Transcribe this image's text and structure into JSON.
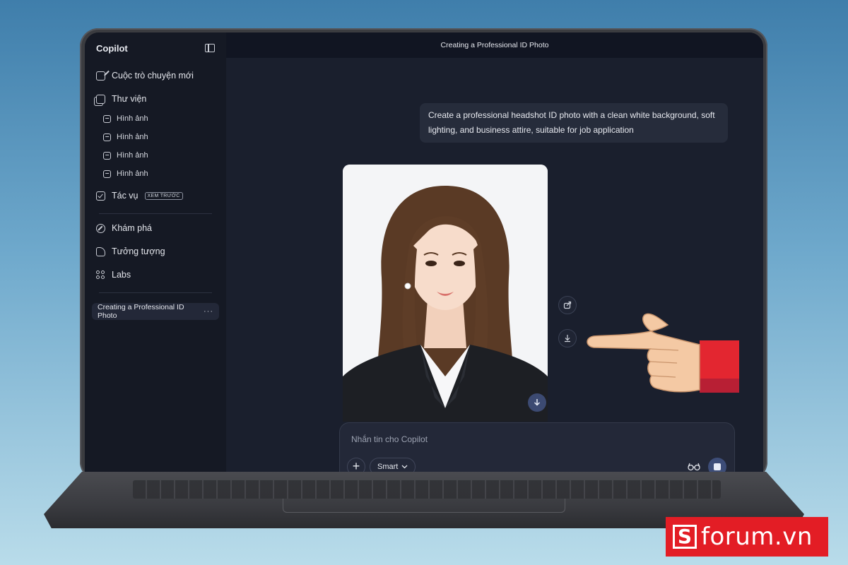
{
  "app": {
    "brand": "Copilot",
    "window_title": "Creating a Professional ID Photo"
  },
  "sidebar": {
    "new_chat": {
      "label": "Cuộc trò chuyện mới",
      "icon": "compose-icon"
    },
    "library": {
      "label": "Thư viện",
      "icon": "library-icon"
    },
    "images": [
      {
        "label": "Hình ảnh",
        "icon": "image-icon"
      },
      {
        "label": "Hình ảnh",
        "icon": "image-icon"
      },
      {
        "label": "Hình ảnh",
        "icon": "image-icon"
      },
      {
        "label": "Hình ảnh",
        "icon": "image-icon"
      }
    ],
    "tasks": {
      "label": "Tác vụ",
      "badge": "XEM TRƯỚC",
      "icon": "checkbox-icon"
    },
    "discover": {
      "label": "Khám phá",
      "icon": "compass-icon"
    },
    "imagine": {
      "label": "Tưởng tượng",
      "icon": "imagine-icon"
    },
    "labs": {
      "label": "Labs",
      "icon": "labs-icon"
    },
    "conversations": [
      {
        "title": "Creating a Professional ID Photo",
        "more": "···"
      }
    ]
  },
  "chat": {
    "user_message": "Create a professional headshot ID photo with a clean white background, soft lighting, and business attire, suitable for job application",
    "generated_image": {
      "type": "headshot-photo",
      "background": "#f4f5f7"
    },
    "actions": [
      "share-icon",
      "download-icon"
    ]
  },
  "composer": {
    "placeholder": "Nhắn tin cho Copilot",
    "mode": "Smart"
  },
  "overlay": {
    "hand": "pointing-hand-icon",
    "logo_text": "forum.vn",
    "logo_color": "#e31d25"
  }
}
